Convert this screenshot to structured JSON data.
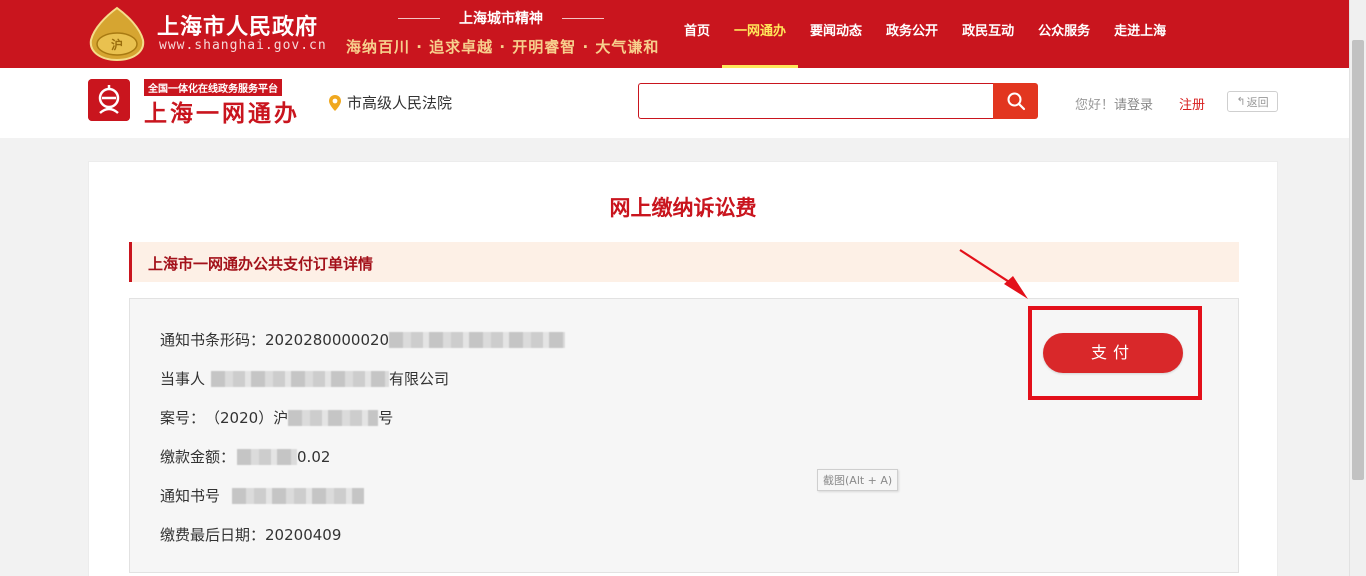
{
  "gov_header": {
    "title": "上海市人民政府",
    "url": "www.shanghai.gov.cn",
    "spirit_title": "上海城市精神",
    "spirit_slogan": "海纳百川 · 追求卓越 · 开明睿智 · 大气谦和",
    "nav": [
      {
        "label": "首页",
        "active": false
      },
      {
        "label": "一网通办",
        "active": true
      },
      {
        "label": "要闻动态",
        "active": false
      },
      {
        "label": "政务公开",
        "active": false
      },
      {
        "label": "政民互动",
        "active": false
      },
      {
        "label": "公众服务",
        "active": false
      },
      {
        "label": "走进上海",
        "active": false
      }
    ]
  },
  "sub_header": {
    "platform_tag": "全国一体化在线政务服务平台",
    "platform_name": "上海一网通办",
    "location": "市高级人民法院",
    "search_value": "",
    "greeting": "您好！",
    "login_label": "请登录",
    "register_label": "注册",
    "back_label": "返回"
  },
  "main": {
    "page_title": "网上缴纳诉讼费",
    "section_title": "上海市一网通办公共支付订单详情",
    "details": {
      "barcode_label": "通知书条形码：",
      "barcode_value": "2020280000020",
      "party_label": "当事人",
      "party_suffix": "有限公司",
      "case_label": "案号：",
      "case_value": "（2020）沪",
      "case_suffix": "号",
      "amount_label": "缴款金额：",
      "amount_suffix": "0.02",
      "notice_label": "通知书号",
      "deadline_label": "缴费最后日期：",
      "deadline_value": "20200409"
    },
    "pay_button": "支付",
    "screenshot_tooltip": "截图(Alt + A)"
  },
  "colors": {
    "brand_red": "#c9151e",
    "nav_active": "#ffe65a",
    "section_bg": "#fdf0e6",
    "pay_button": "#d9282a",
    "highlight": "#e3101a"
  },
  "icons": {
    "emblem": "shanghai-emblem-icon",
    "ywt_logo": "ywt-logo-icon",
    "location": "map-pin-icon",
    "search": "search-icon",
    "back": "back-arrow-icon"
  }
}
